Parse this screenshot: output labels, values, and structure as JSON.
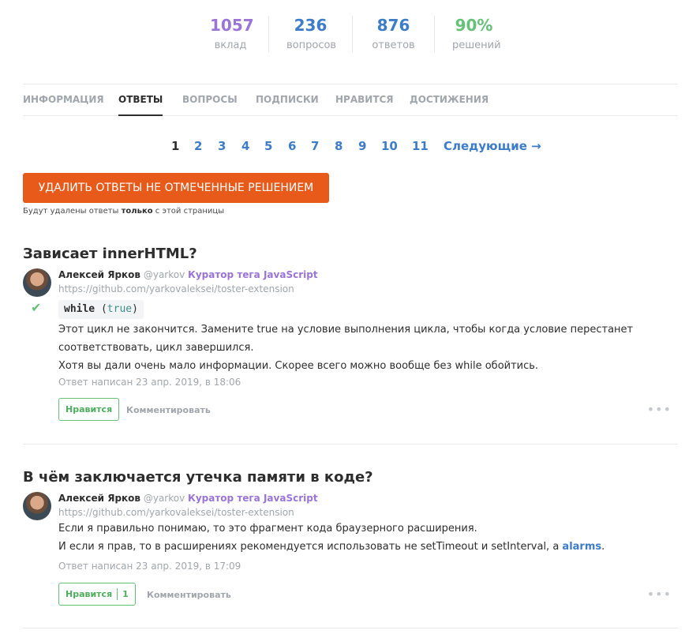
{
  "stats": [
    {
      "value": "1057",
      "label": "вклад",
      "color": "#9a74d6"
    },
    {
      "value": "236",
      "label": "вопросов",
      "color": "#3d7cc9"
    },
    {
      "value": "876",
      "label": "ответов",
      "color": "#3d7cc9"
    },
    {
      "value": "90%",
      "label": "решений",
      "color": "#65c178"
    }
  ],
  "tabs": [
    "ИНФОРМАЦИЯ",
    "ОТВЕТЫ",
    "ВОПРОСЫ",
    "ПОДПИСКИ",
    "НРАВИТСЯ",
    "ДОСТИЖЕНИЯ"
  ],
  "active_tab": "ОТВЕТЫ",
  "pagination": {
    "pages": [
      "1",
      "2",
      "3",
      "4",
      "5",
      "6",
      "7",
      "8",
      "9",
      "10",
      "11"
    ],
    "current": "1",
    "next_label": "Следующие →"
  },
  "delete": {
    "button_label": "УДАЛИТЬ ОТВЕТЫ НЕ ОТМЕЧЕННЫЕ РЕШЕНИЕМ",
    "note_before": "Будут удалены ответы ",
    "note_bold": "только",
    "note_after": " с этой страницы"
  },
  "answers": [
    {
      "question_title": "Зависает innerHTML?",
      "author_name": "Алексей Ярков",
      "author_nick": "@yarkov",
      "author_role": "Куратор тега JavaScript",
      "author_link": "https://github.com/yarkovaleksei/toster-extension",
      "is_solution": true,
      "code_keyword": "while",
      "code_open": " (",
      "code_literal": "true",
      "code_close": ")",
      "lines": [
        "Этот цикл не закончится. Замените true на условие выполнения цикла, чтобы когда условие перестанет",
        "соответствовать, цикл завершился.",
        "Хотя вы дали очень мало информации. Скорее всего можно вообще без while обойтись."
      ],
      "time": "Ответ написан 23 апр. 2019, в 18:06",
      "like_label": "Нравится",
      "like_count": "",
      "comment_label": "Комментировать",
      "more_icon": "ellipsis-icon"
    },
    {
      "question_title": "В чём заключается утечка памяти в коде?",
      "author_name": "Алексей Ярков",
      "author_nick": "@yarkov",
      "author_role": "Куратор тега JavaScript",
      "author_link": "https://github.com/yarkovaleksei/toster-extension",
      "is_solution": false,
      "line_1": "Если я правильно понимаю, то это фрагмент кода браузерного расширения.",
      "line_2_before": "И если я прав, то в расширениях рекомендуется использовать не setTimeout и setInterval, а ",
      "line_2_link": "alarms",
      "line_2_after": ".",
      "time": "Ответ написан 23 апр. 2019, в 17:09",
      "like_label": "Нравится",
      "like_count": "1",
      "comment_label": "Комментировать",
      "more_icon": "ellipsis-icon"
    }
  ]
}
